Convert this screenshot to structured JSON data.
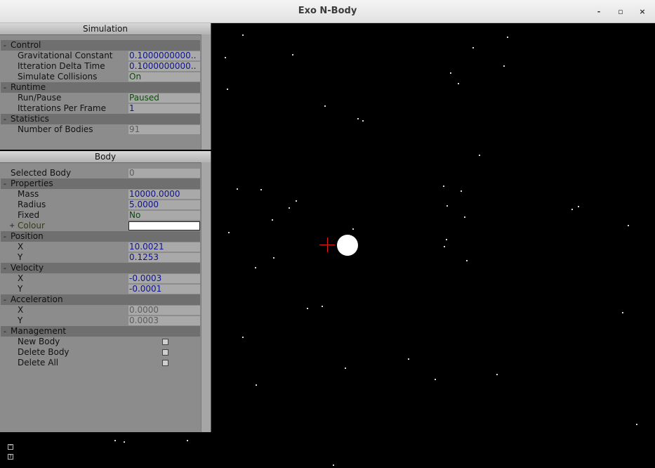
{
  "window": {
    "title": "Exo N-Body",
    "minimize": "-",
    "maximize": "▫",
    "close": "×"
  },
  "simulation": {
    "title": "Simulation",
    "control": "Control",
    "gravitational_constant": {
      "label": "Gravitational Constant",
      "value": "0.1000000000.."
    },
    "iteration_delta_time": {
      "label": "Itteration Delta Time",
      "value": "0.1000000000.."
    },
    "simulate_collisions": {
      "label": "Simulate Collisions",
      "value": "On"
    },
    "runtime": "Runtime",
    "run_pause": {
      "label": "Run/Pause",
      "value": "Paused"
    },
    "iterations_per_frame": {
      "label": "Itterations Per Frame",
      "value": "1"
    },
    "statistics": "Statistics",
    "number_of_bodies": {
      "label": "Number of Bodies",
      "value": "91"
    }
  },
  "body": {
    "title": "Body",
    "selected_body": {
      "label": "Selected Body",
      "value": "0"
    },
    "properties": "Properties",
    "mass": {
      "label": "Mass",
      "value": "10000.0000"
    },
    "radius": {
      "label": "Radius",
      "value": "5.0000"
    },
    "fixed": {
      "label": "Fixed",
      "value": "No"
    },
    "colour": {
      "label": "Colour",
      "value": "#ffffff"
    },
    "position": "Position",
    "pos_x": {
      "label": "X",
      "value": "10.0021"
    },
    "pos_y": {
      "label": "Y",
      "value": "0.1253"
    },
    "velocity": "Velocity",
    "vel_x": {
      "label": "X",
      "value": "-0.0003"
    },
    "vel_y": {
      "label": "Y",
      "value": "-0.0001"
    },
    "acceleration": "Acceleration",
    "acc_x": {
      "label": "X",
      "value": "0.0000"
    },
    "acc_y": {
      "label": "Y",
      "value": "0.0003"
    },
    "management": "Management",
    "new_body": "New Body",
    "delete_body": "Delete Body",
    "delete_all": "Delete All"
  },
  "toggles": {
    "collapse": "-",
    "expand": "+"
  }
}
